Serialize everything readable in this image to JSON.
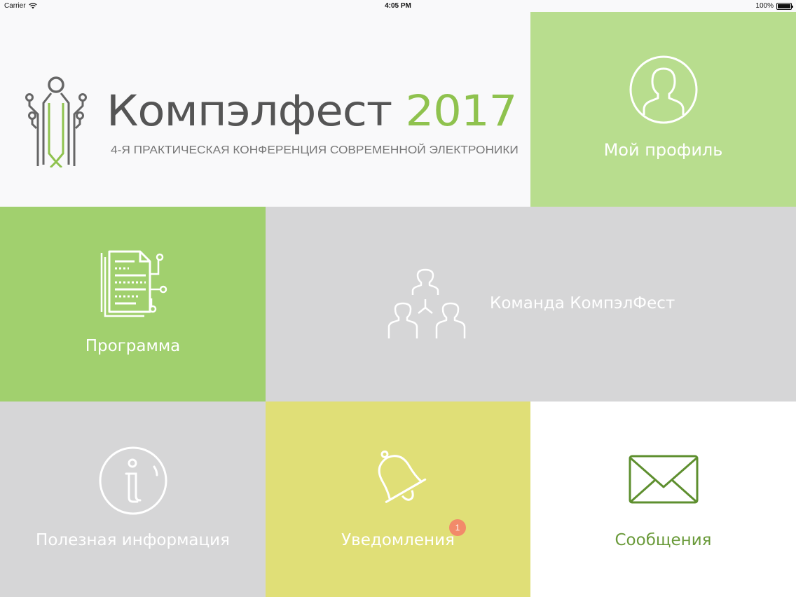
{
  "status_bar": {
    "carrier": "Carrier",
    "time": "4:05 PM",
    "battery": "100%"
  },
  "header": {
    "title": "Компэлфест",
    "year": "2017",
    "subtitle": "4-Я ПРАКТИЧЕСКАЯ КОНФЕРЕНЦИЯ СОВРЕМЕННОЙ ЭЛЕКТРОНИКИ"
  },
  "tiles": {
    "profile": {
      "label": "Мой профиль",
      "icon": "user-avatar-icon"
    },
    "program": {
      "label": "Программа",
      "icon": "schedule-document-icon"
    },
    "team": {
      "label": "Команда КомпэлФест",
      "icon": "team-hierarchy-icon"
    },
    "info": {
      "label": "Полезная информация",
      "icon": "info-icon"
    },
    "notifications": {
      "label": "Уведомления",
      "icon": "bell-icon",
      "badge": "1"
    },
    "messages": {
      "label": "Сообщения",
      "icon": "envelope-icon"
    }
  },
  "colors": {
    "brand_green": "#8fc24e",
    "profile_bg": "#b8dd8e",
    "program_bg": "#a1d06e",
    "gray_bg": "#d6d6d7",
    "notify_bg": "#e0df77",
    "messages_text": "#6a9a3a",
    "badge": "#f28a6a"
  }
}
